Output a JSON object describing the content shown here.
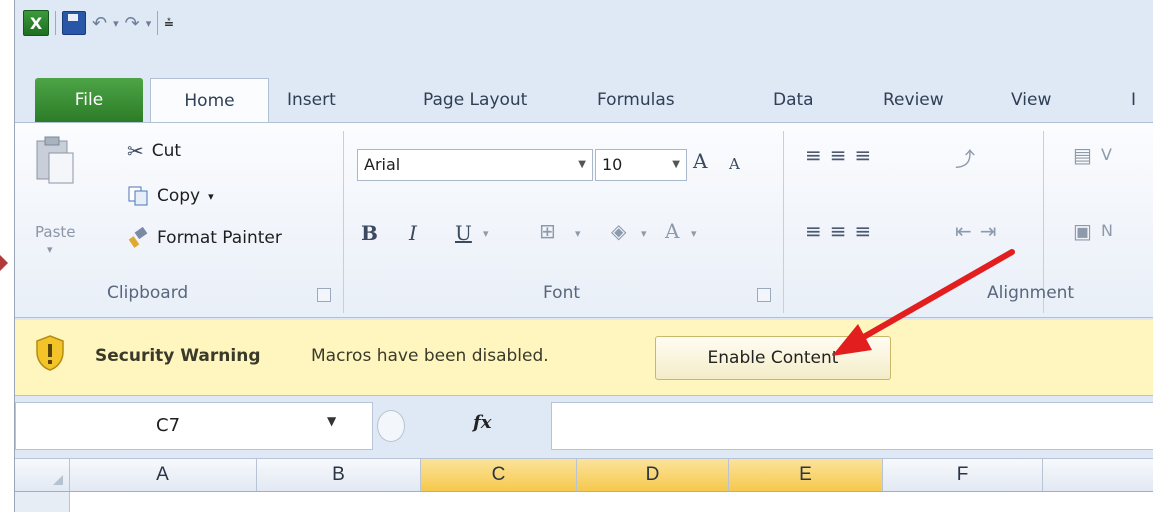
{
  "tabs": [
    "File",
    "Home",
    "Insert",
    "Page Layout",
    "Formulas",
    "Data",
    "Review",
    "View",
    "I"
  ],
  "clipboard": {
    "paste_label": "Paste",
    "cut_label": "Cut",
    "copy_label": "Copy",
    "format_painter_label": "Format Painter",
    "group_label": "Clipboard"
  },
  "font": {
    "name": "Arial",
    "size": "10",
    "bold": "B",
    "italic": "I",
    "underline": "U",
    "group_label": "Font",
    "grow": "A",
    "shrink": "A",
    "color_glyph": "A"
  },
  "alignment": {
    "group_label": "Alignment",
    "wrap_partial": "V",
    "merge_partial": "N"
  },
  "security": {
    "title": "Security Warning",
    "message": "Macros have been disabled.",
    "button": "Enable Content"
  },
  "formula_bar": {
    "name_box": "C7",
    "fx": "fx",
    "value": ""
  },
  "columns": [
    "A",
    "B",
    "C",
    "D",
    "E",
    "F"
  ],
  "selected_columns": [
    "C",
    "D",
    "E"
  ],
  "colors": {
    "file_tab": "#2c7c27",
    "security_bar": "#fff6bf",
    "selected_col": "#f6c94e",
    "annotation_arrow": "#e21e1e"
  },
  "icons": [
    "excel-icon",
    "save-icon",
    "undo-icon",
    "redo-icon",
    "customize-qat-icon",
    "paste-icon",
    "cut-icon",
    "copy-icon",
    "format-painter-icon",
    "shield-warning-icon",
    "fx-icon"
  ]
}
